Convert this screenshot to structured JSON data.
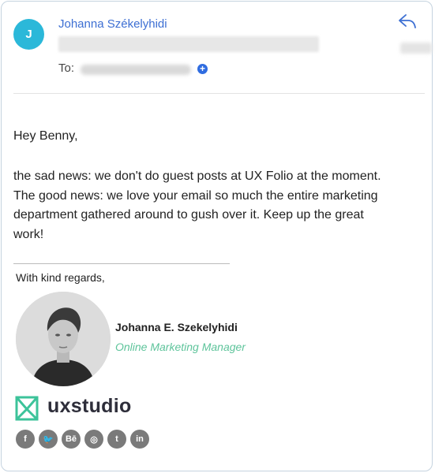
{
  "header": {
    "avatar_initial": "J",
    "sender_name": "Johanna Székelyhidi",
    "to_label": "To:",
    "add_recipient_symbol": "+"
  },
  "message": {
    "greeting": "Hey Benny,",
    "lines": [
      "the sad news: we don't do guest posts at UX Folio at the moment.",
      "The good news: we love your email so much the entire marketing",
      "department gathered around to gush over it. Keep up the great",
      "work!"
    ]
  },
  "signature": {
    "closing": "With kind regards,",
    "name": "Johanna E. Szekelyhidi",
    "role": "Online Marketing Manager",
    "company": "uxstudio",
    "socials": [
      {
        "icon": "facebook-icon",
        "glyph": "f"
      },
      {
        "icon": "twitter-icon",
        "glyph": "🐦"
      },
      {
        "icon": "behance-icon",
        "glyph": "Bē"
      },
      {
        "icon": "dribbble-icon",
        "glyph": "◎"
      },
      {
        "icon": "tumblr-icon",
        "glyph": "t"
      },
      {
        "icon": "linkedin-icon",
        "glyph": "in"
      }
    ]
  },
  "colors": {
    "avatar": "#2bb8d9",
    "sender": "#3d6fd3",
    "role": "#5ec49b",
    "logo_mark": "#3cc39a",
    "social": "#7a7a7a"
  },
  "icons": {
    "reply": "reply-arrow-icon",
    "add_recipient": "plus-circle-icon",
    "logo": "uxstudio-logo-icon"
  }
}
